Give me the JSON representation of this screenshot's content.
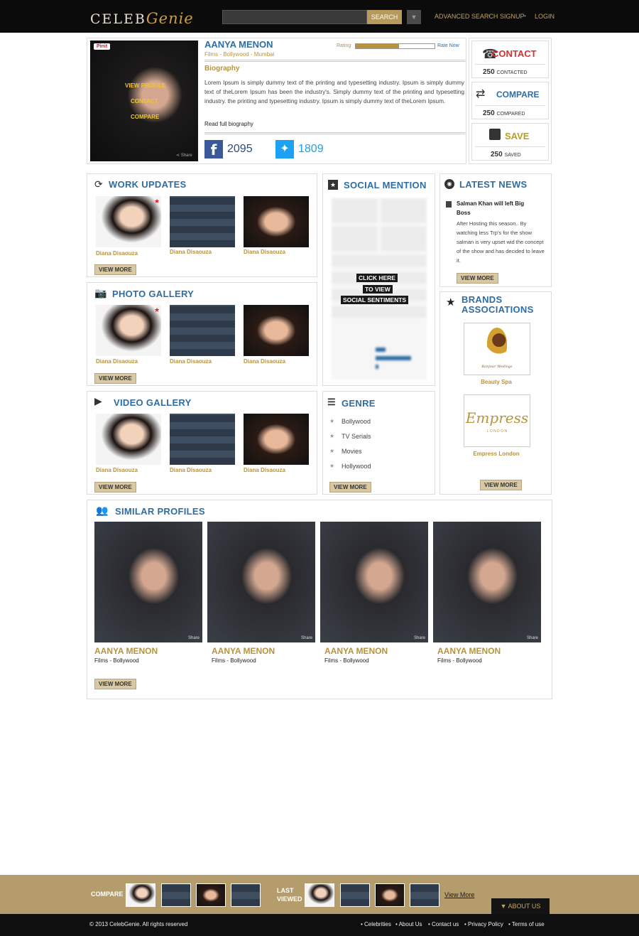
{
  "header": {
    "logo_main": "CELEB",
    "logo_script": "Genie",
    "search_placeholder": "",
    "search_button": "SEARCH",
    "nav": [
      "ADVANCED SEARCH",
      "SIGNUP",
      "LOGIN"
    ]
  },
  "profile": {
    "pin_label": "Pinit",
    "overlay_links": [
      "VIEW PROFILE",
      "CONTACT",
      "COMPARE"
    ],
    "share": "Share",
    "name": "AANYA MENON",
    "meta": "Films - Bollywood - Mumbai",
    "rating_label": "Rating",
    "rating_fraction": 0.55,
    "rate_now": "Rate Now",
    "bio_heading": "Biography",
    "bio": "Lorem Ipsum is simply dummy text of the printing and typesetting industry. Ipsum is simply dummy text of theLorem Ipsum has been the industry's. Simply dummy text of the printing and typesetting industry. the printing and typesetting industry. Ipsum is simply dummy text of theLorem Ipsum.",
    "bio_link": "Read full biography",
    "facebook_count": "2095",
    "twitter_count": "1809"
  },
  "actions": [
    {
      "label": "CONTACT",
      "count": "250",
      "suffix": "CONTACTED",
      "color": "#d33333"
    },
    {
      "label": "COMPARE",
      "count": "250",
      "suffix": "COMPARED",
      "color": "#2e6da4"
    },
    {
      "label": "SAVE",
      "count": "250",
      "suffix": "SAVED",
      "color": "#b8a01a"
    }
  ],
  "work_updates": {
    "title": "WORK UPDATES",
    "items": [
      "Diana Disaouza",
      "Diana Disaouza",
      "Diana Disaouza"
    ],
    "view_more": "VIEW MORE"
  },
  "photo_gallery": {
    "title": "PHOTO GALLERY",
    "items": [
      "Diana Disaouza",
      "Diana Disaouza",
      "Diana Disaouza"
    ],
    "view_more": "VIEW MORE"
  },
  "video_gallery": {
    "title": "VIDEO GALLERY",
    "items": [
      "Diana Disaouza",
      "Diana Disaouza",
      "Diana Disaouza"
    ],
    "view_more": "VIEW MORE"
  },
  "social_mention": {
    "title": "SOCIAL MENTION",
    "overlay_lines": [
      "CLICK HERE",
      "TO VIEW",
      "SOCIAL SENTIMENTS"
    ]
  },
  "genre": {
    "title": "GENRE",
    "items": [
      "Bollywood",
      "TV Serials",
      "Movies",
      "Hollywood"
    ],
    "view_more": "VIEW MORE"
  },
  "news": {
    "title": "LATEST NEWS",
    "headline": "Salman Khan will left Big Boss",
    "body": "After Hosting this season.. By watching less Trp's for the show salman is very upset wid the concept of the show and has decided to leave it.",
    "view_more": "VIEW MORE"
  },
  "brands": {
    "title": "BRANDS ASSOCIATIONS",
    "items": [
      {
        "name": "Beauty Spa",
        "logo_text": "Bonjour Wedings"
      },
      {
        "name": "Empress London",
        "logo_text": "Empress",
        "logo_sub": "L O N D O N"
      }
    ],
    "view_more": "VIEW MORE"
  },
  "similar": {
    "title": "SIMILAR PROFILES",
    "share": "Share",
    "items": [
      {
        "name": "AANYA MENON",
        "meta": "Films - Bollywood"
      },
      {
        "name": "AANYA MENON",
        "meta": "Films - Bollywood"
      },
      {
        "name": "AANYA MENON",
        "meta": "Films - Bollywood"
      },
      {
        "name": "AANYA MENON",
        "meta": "Films - Bollywood"
      }
    ],
    "view_more": "VIEW MORE"
  },
  "compare_bar": {
    "compare_label": "COMPARE",
    "last_viewed_line1": "LAST",
    "last_viewed_line2": "VIEWED",
    "view_more": "View More",
    "about_us": "ABOUT US"
  },
  "footer": {
    "copyright": "© 2013 CelebGenie. All rights reserved",
    "links": [
      "Celebrities",
      "About Us",
      "Contact us",
      "Privacy Policy",
      "Terms of use"
    ]
  }
}
